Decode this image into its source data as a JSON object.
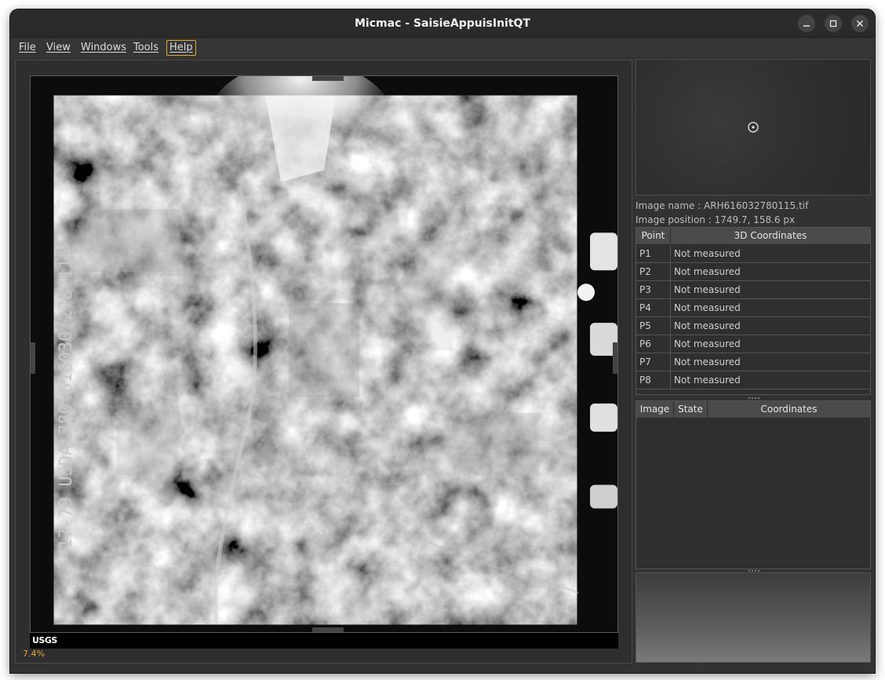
{
  "window": {
    "title": "Micmac - SaisieAppuisInitQT"
  },
  "menu": [
    {
      "label": "File"
    },
    {
      "label": "View"
    },
    {
      "label": "Windows"
    },
    {
      "label": "Tools"
    },
    {
      "label": "Help",
      "active": true
    }
  ],
  "viewer": {
    "zoom": "7.4%",
    "watermark": "USGS"
  },
  "info": {
    "image_name": "Image name : ARH616032780115.tif",
    "image_position": "Image position : 1749.7, 158.6 px"
  },
  "points_table": {
    "headers": [
      "Point",
      "3D Coordinates"
    ],
    "rows": [
      {
        "point": "P1",
        "coords": "Not measured"
      },
      {
        "point": "P2",
        "coords": "Not measured"
      },
      {
        "point": "P3",
        "coords": "Not measured"
      },
      {
        "point": "P4",
        "coords": "Not measured"
      },
      {
        "point": "P5",
        "coords": "Not measured"
      },
      {
        "point": "P6",
        "coords": "Not measured"
      },
      {
        "point": "P7",
        "coords": "Not measured"
      },
      {
        "point": "P8",
        "coords": "Not measured"
      }
    ]
  },
  "images_table": {
    "headers": [
      "Image",
      "State",
      "Coordinates"
    ]
  },
  "colors": {
    "accent": "#e3a83a",
    "zoom_text": "#e3a33a"
  }
}
